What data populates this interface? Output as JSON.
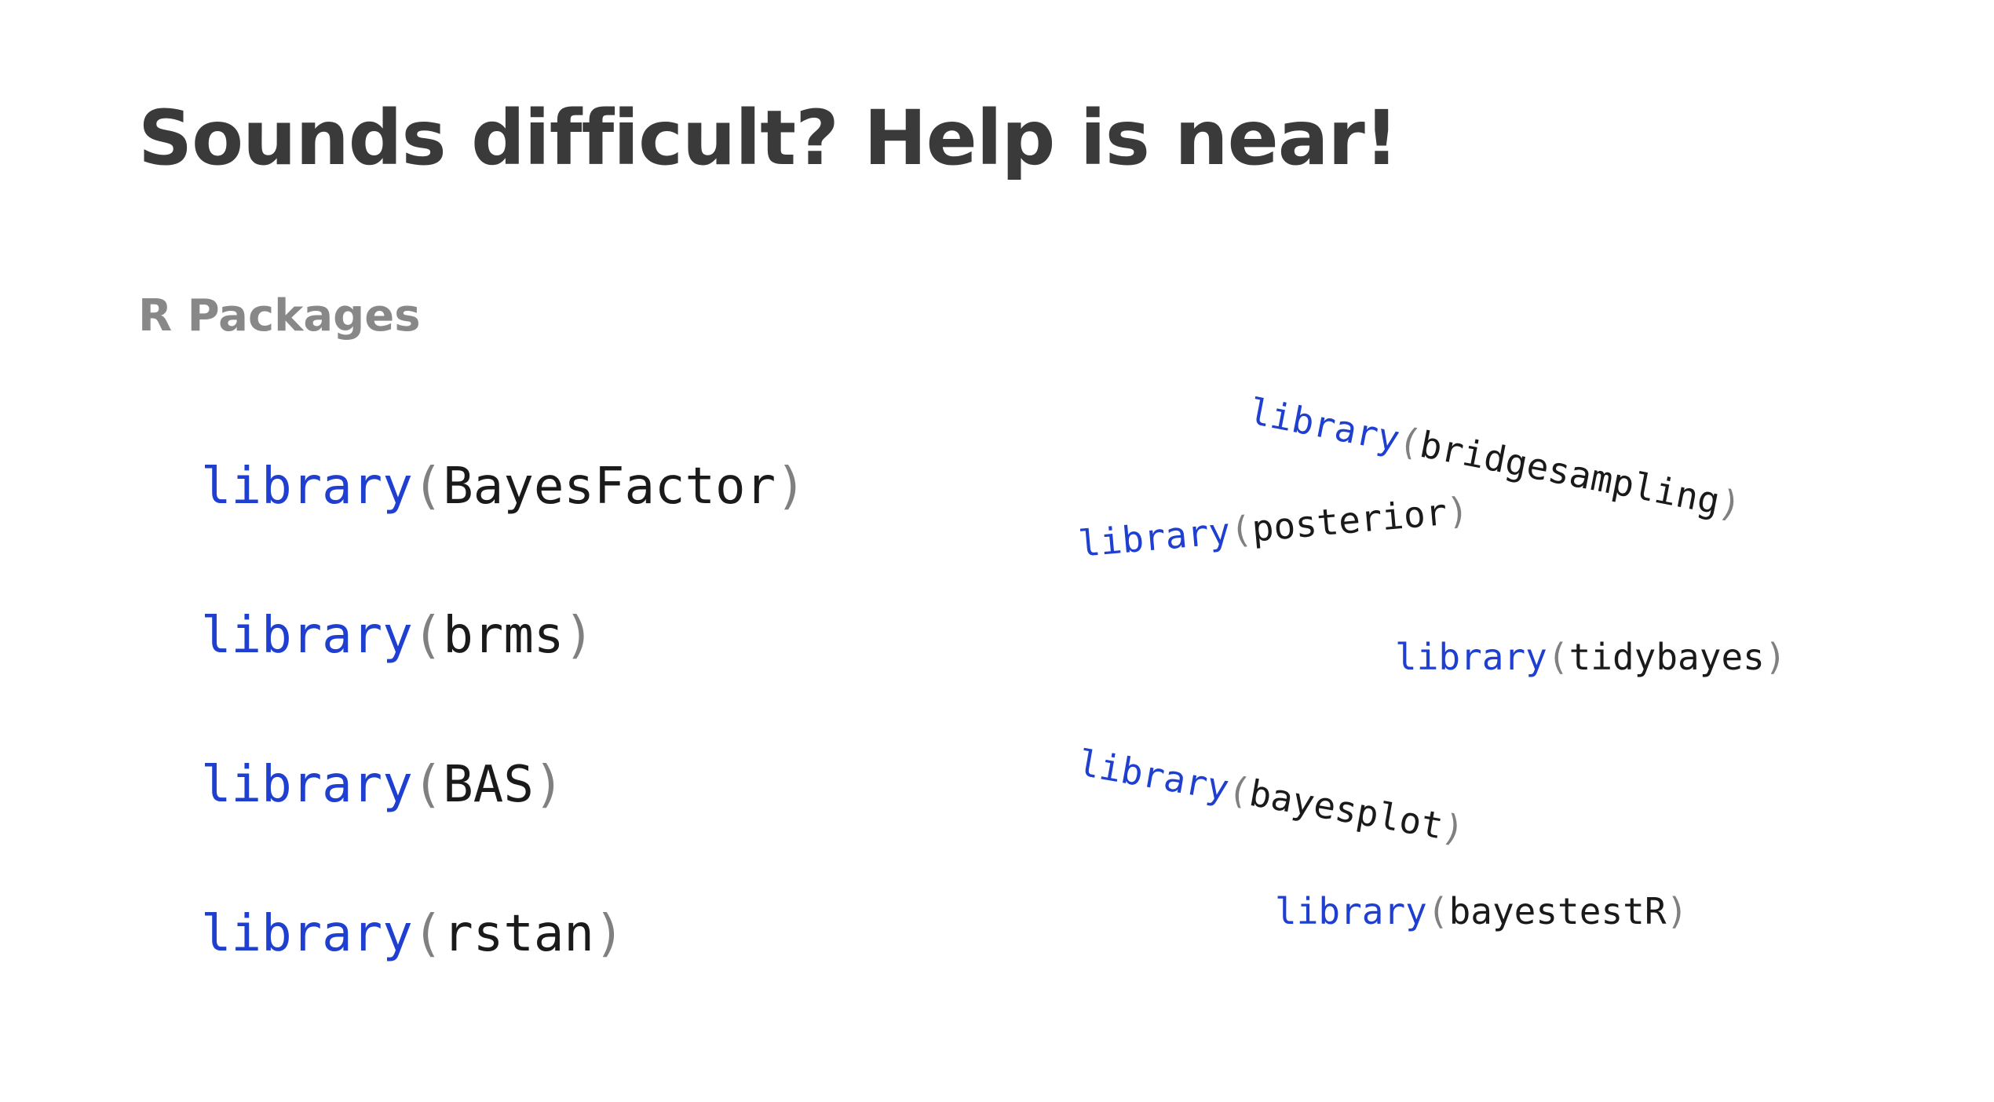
{
  "slide": {
    "title": "Sounds difficult? Help is near!",
    "subtitle": "R Packages",
    "code_keyword": "library",
    "open_paren": "(",
    "close_paren": ")",
    "packages": {
      "bayesfactor": "BayesFactor",
      "brms": "brms",
      "bas": "BAS",
      "rstan": "rstan",
      "bridgesampling": "bridgesampling",
      "posterior": "posterior",
      "tidybayes": "tidybayes",
      "bayesplot": "bayesplot",
      "bayestestr": "bayestestR"
    }
  },
  "colors": {
    "title": "#3a3a3a",
    "subtitle": "#888888",
    "keyword": "#1e3fd0",
    "paren": "#808080",
    "package": "#1a1a1a"
  }
}
